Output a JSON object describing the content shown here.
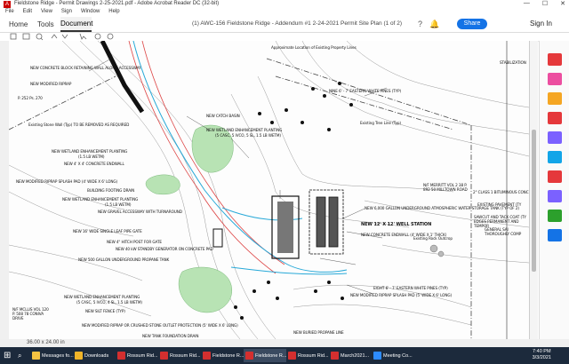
{
  "window": {
    "title": "Fieldstone Ridge - Permit Drawings 2-25-2021.pdf - Adobe Acrobat Reader DC (32-bit)",
    "controls": [
      "—",
      "☐",
      "✕"
    ]
  },
  "menu": [
    "File",
    "Edit",
    "View",
    "Sign",
    "Window",
    "Help"
  ],
  "toolbar": {
    "home": "Home",
    "tools": "Tools",
    "document": "Document",
    "doc_title": "(1) AWC-156 Fieldstone Ridge - Addendum #1 2-24-2021 Permit Site Plan (1 of 2)",
    "share": "Share",
    "sign_in": "Sign In"
  },
  "status": {
    "page_size": "36.00 x 24.00 in"
  },
  "drawing": {
    "labels": {
      "retaining_wall": "NEW CONCRETE BLOCK RETAINING WALL ALONG ACCESSWAY",
      "riprap_top": "NEW MODIFIED RIPRAP",
      "stone_wall": "Existing Stone Wall (Typ) TO BE REMOVED AS REQUIRED",
      "catch_basin": "NEW CATCH BASIN",
      "wetland_1": "NEW WETLAND ENHANCEMENT PLANTING",
      "wetland_1_sub": "(5 CASC, 5 IVCO, 5 SL, 1.5 LB WETM)",
      "wetland_2": "NEW WETLAND ENHANCEMENT PLANTING",
      "wetland_2_sub": "(1.5 LB WETM)",
      "endwall_1": "NEW 4' X 4' CONCRETE ENDWALL",
      "splash_pad": "NEW MODIFIED RIPRAP SPLASH PAD (4' WIDE X 6' LONG)",
      "footing_drain": "BUILDING FOOTING DRAIN",
      "wetland_3": "NEW WETLAND ENHANCEMENT PLANTING",
      "wetland_3_sub": "(1.5 LB WETM)",
      "gravel_access": "NEW GRAVEL ACCESSWAY WITH TURNAROUND",
      "gate": "NEW 16' WIDE SINGLE LEAF PIPE GATE",
      "hitch_post": "NEW 4\" HITCH POST FOR GATE",
      "generator": "NEW 40 kW STANDBY GENERATOR ON CONCRETE PAD",
      "propane_tank": "NEW 500 GALLON UNDERGROUND PROPANE TANK",
      "wetland_4": "NEW WETLAND ENHANCEMENT PLANTING",
      "wetland_4_sub": "(5 CASC, 5 IVCO, 4 SL, 1.5 LB WETM)",
      "silt_fence": "NEW SILT FENCE (TYP)",
      "outlet_protection": "NEW MODIFIED RIPRAP OR CRUSHED STONE OUTLET PROTECTION (5' WIDE X 6' LONG)",
      "tank_drain": "NEW TANK FOUNDATION DRAIN",
      "property_lines": "Approximate Location of Existing Property Lines",
      "pines_1": "NINE 6' - 7' EASTERN WHITE PINES (TYP)",
      "tree_line": "Existing Tree Line (Typ)",
      "storage_tank": "NEW 6,000 GALLON UNDERGROUND ATMOSPHERIC WATER STORAGE TANK (TYP OF 2)",
      "well_station": "NEW 12' X 12' WELL STATION",
      "endwall_2": "NEW CONCRETE ENDWALL (4' WIDE X 1' THICK)",
      "rock_outcrop": "Existing Rock Outcrop",
      "pines_2": "EIGHT 6' - 7' EASTERN WHITE PINES (TYP)",
      "splash_pad_2": "NEW MODIFIED RIPRAP SPLASH PAD (5' WIDE X 6' LONG)",
      "propane_line": "NEW BURIED PROPANE LINE",
      "stabilization": "STABILIZATION",
      "bituminous": "2\" CLASS 1 BITUMINOUS CONC",
      "existing_pavement": "EXISTING PAVEMENT (TY",
      "sawcut": "SAWCUT AND TACK COAT (TY EDGES PERMANENT AND TEMPOR",
      "general": "GENERAL SAI THOROUGHLY COMP",
      "parcel_left": "P. 252 Ps. 270",
      "parcel_left2": "N/F MCLLIS VOL 120 P. 508 78 CONIVA DRIVE",
      "parcel_right": "N/F MERRITT VOL 2 38 P. 892 50 MILLTOWN ROAD"
    }
  },
  "taskbar": {
    "items": [
      {
        "label": "Messages fo...",
        "color": "#f6c342"
      },
      {
        "label": "Downloads",
        "color": "#f0b429"
      },
      {
        "label": "Rossum Rid...",
        "color": "#d32f2f"
      },
      {
        "label": "Rossum Rid...",
        "color": "#d32f2f"
      },
      {
        "label": "Fieldstone R...",
        "color": "#d32f2f"
      },
      {
        "label": "Fieldstone R...",
        "color": "#d32f2f"
      },
      {
        "label": "Rossum Rid...",
        "color": "#d32f2f"
      },
      {
        "label": "March2021...",
        "color": "#d32f2f"
      },
      {
        "label": "Meeting Co...",
        "color": "#2d8cff"
      }
    ],
    "time": "7:40 PM",
    "date": "3/3/2021"
  }
}
